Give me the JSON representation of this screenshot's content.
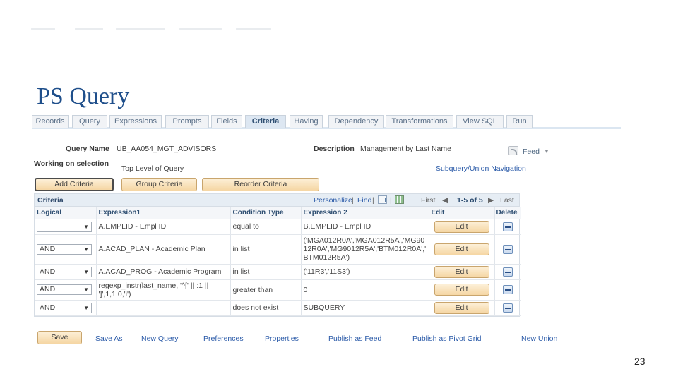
{
  "slide": {
    "title": "PS Query",
    "page_number": "23"
  },
  "tabs": [
    {
      "label": "Records"
    },
    {
      "label": "Query"
    },
    {
      "label": "Expressions"
    },
    {
      "label": "Prompts"
    },
    {
      "label": "Fields"
    },
    {
      "label": "Criteria",
      "active": true
    },
    {
      "label": "Having"
    },
    {
      "label": "Dependency"
    },
    {
      "label": "Transformations"
    },
    {
      "label": "View SQL"
    },
    {
      "label": "Run"
    }
  ],
  "query": {
    "name_label": "Query Name",
    "name_value": "UB_AA054_MGT_ADVISORS",
    "description_label": "Description",
    "description_value": "Management by Last Name",
    "feed_label": "Feed",
    "feed_icon": "rss-feed-icon",
    "working_label": "Working on selection",
    "working_value": "Top Level of Query",
    "subquery_link": "Subquery/Union Navigation"
  },
  "actions": {
    "add_criteria": "Add Criteria",
    "group_criteria": "Group Criteria",
    "reorder_criteria": "Reorder Criteria"
  },
  "grid": {
    "title": "Criteria",
    "personalize": "Personalize",
    "find": "Find",
    "sep": "|",
    "first": "First",
    "range": "1-5 of 5",
    "last": "Last",
    "columns": [
      "Logical",
      "Expression1",
      "Condition Type",
      "Expression 2",
      "Edit",
      "Delete"
    ],
    "rows": [
      {
        "logical": "",
        "expr1": "A.EMPLID - Empl ID",
        "cond": "equal to",
        "expr2": "B.EMPLID - Empl ID",
        "edit": "Edit"
      },
      {
        "logical": "AND",
        "expr1": "A.ACAD_PLAN - Academic Plan",
        "cond": "in list",
        "expr2": "('MGA012R0A','MGA012R5A','MG9012R0A','MG9012R5A','BTM012R0A','BTM012R5A')",
        "edit": "Edit"
      },
      {
        "logical": "AND",
        "expr1": "A.ACAD_PROG - Academic Program",
        "cond": "in list",
        "expr2": "('11R3','11S3')",
        "edit": "Edit"
      },
      {
        "logical": "AND",
        "expr1": "regexp_instr(last_name, '^[' || :1 || ']',1,1,0,'i')",
        "cond": "greater than",
        "expr2": "0",
        "edit": "Edit"
      },
      {
        "logical": "AND",
        "expr1": "",
        "cond": "does not exist",
        "expr2": "SUBQUERY",
        "edit": "Edit"
      }
    ]
  },
  "footer": {
    "save": "Save",
    "save_as": "Save As",
    "new_query": "New Query",
    "preferences": "Preferences",
    "properties": "Properties",
    "publish_feed": "Publish as Feed",
    "publish_pivot": "Publish as Pivot Grid",
    "new_union": "New Union"
  }
}
